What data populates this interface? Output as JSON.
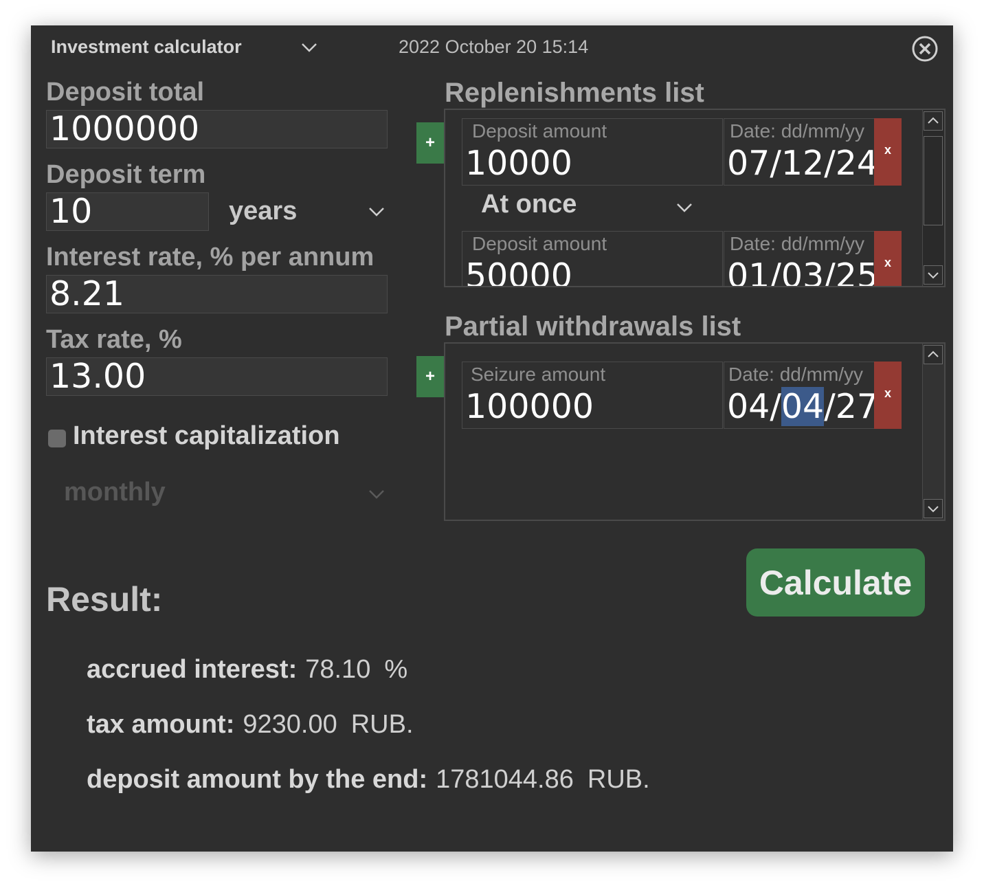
{
  "header": {
    "title": "Investment calculator",
    "datetime": "2022 October 20 15:14"
  },
  "form": {
    "deposit_total_label": "Deposit total",
    "deposit_total_value": "1000000",
    "deposit_term_label": "Deposit term",
    "deposit_term_value": "10",
    "deposit_term_unit": "years",
    "interest_rate_label": "Interest rate, % per annum",
    "interest_rate_value": "8.21",
    "tax_rate_label": "Tax rate, %",
    "tax_rate_value": "13.00",
    "capitalization_label": "Interest capitalization",
    "capitalization_checked": false,
    "capitalization_period": "monthly"
  },
  "replenishments": {
    "title": "Replenishments list",
    "add_label": "+",
    "delete_label": "x",
    "items": [
      {
        "amount_placeholder": "Deposit amount",
        "amount": "10000",
        "date_placeholder": "Date: dd/mm/yy",
        "date": "07/12/24",
        "frequency": "At once"
      },
      {
        "amount_placeholder": "Deposit amount",
        "amount": "50000",
        "date_placeholder": "Date: dd/mm/yy",
        "date": "01/03/25"
      }
    ]
  },
  "withdrawals": {
    "title": "Partial withdrawals list",
    "add_label": "+",
    "delete_label": "x",
    "items": [
      {
        "amount_placeholder": "Seizure amount",
        "amount": "100000",
        "date_placeholder": "Date: dd/mm/yy",
        "date_part1": "04/",
        "date_selected": "04",
        "date_part3": "/27"
      }
    ]
  },
  "actions": {
    "calculate_label": "Calculate"
  },
  "result": {
    "title": "Result:",
    "accrued_interest_label": "accrued interest:",
    "accrued_interest_value": "78.10",
    "accrued_interest_unit": "%",
    "tax_amount_label": "tax amount:",
    "tax_amount_value": "9230.00",
    "tax_amount_unit": "RUB.",
    "deposit_end_label": "deposit amount by the end:",
    "deposit_end_value": "1781044.86",
    "deposit_end_unit": "RUB."
  },
  "colors": {
    "window_bg": "#2e2e2e",
    "accent_green": "#3a7a48",
    "delete_red": "#943a33",
    "selection_blue": "#3c5a8a"
  },
  "icons": {
    "dropdown": "chevron-down-icon",
    "close": "close-circle-icon",
    "scroll_up": "chevron-up-icon",
    "scroll_down": "chevron-down-icon"
  }
}
